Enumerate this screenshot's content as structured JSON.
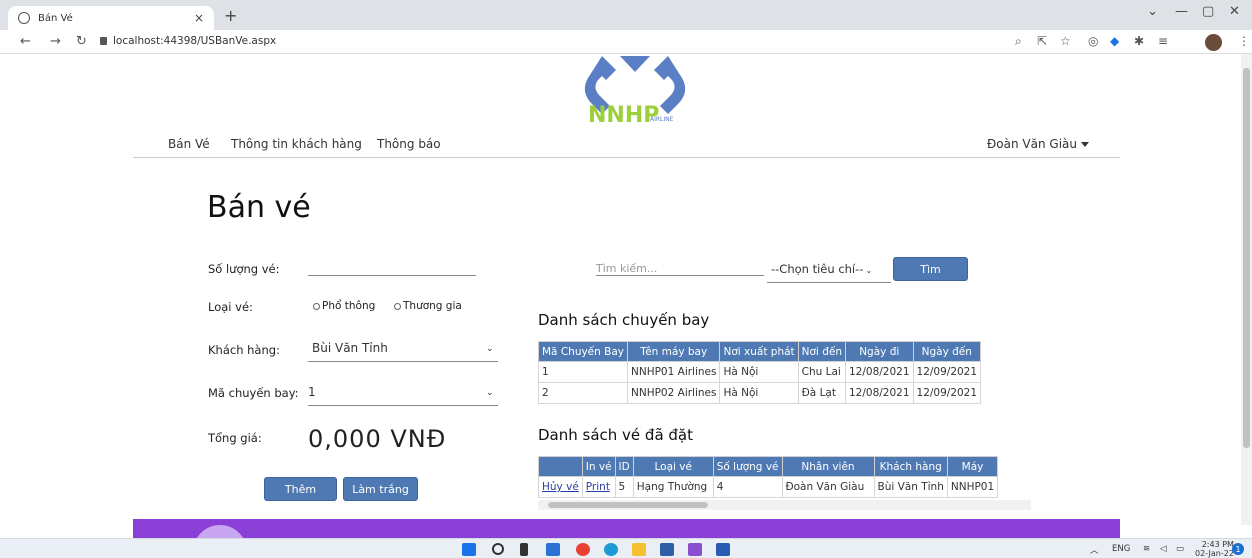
{
  "browser": {
    "tab_title": "Bán Vé",
    "tab_close": "×",
    "new_tab": "+",
    "url": "localhost:44398/USBanVe.aspx"
  },
  "nav": {
    "items": [
      "Bán Vé",
      "Thông tin khách hàng",
      "Thông báo"
    ],
    "user": "Đoàn Văn Giàu"
  },
  "logo": {
    "text": "NNHP",
    "sub": "AIRLINE"
  },
  "page": {
    "title": "Bán vé"
  },
  "form": {
    "qty_label": "Số lượng vé:",
    "qty_value": "",
    "type_label": "Loại vé:",
    "type_options": [
      "Phổ thông",
      "Thương gia"
    ],
    "customer_label": "Khách hàng:",
    "customer_value": "Bùi Văn Tỉnh",
    "flight_label": "Mã chuyến bay:",
    "flight_value": "1",
    "total_label": "Tổng giá:",
    "total_value": "0,000 VNĐ",
    "add_button": "Thêm",
    "clear_button": "Làm trắng"
  },
  "search": {
    "placeholder": "Tìm kiếm...",
    "criteria": "--Chọn tiêu chí--",
    "button": "Tìm"
  },
  "flights": {
    "title": "Danh sách chuyến bay",
    "headers": [
      "Mã Chuyến Bay",
      "Tên máy bay",
      "Nơi xuất phát",
      "Nơi đến",
      "Ngày đi",
      "Ngày đến"
    ],
    "rows": [
      [
        "1",
        "NNHP01 Airlines",
        "Hà Nội",
        "Chu Lai",
        "12/08/2021",
        "12/09/2021"
      ],
      [
        "2",
        "NNHP02 Airlines",
        "Hà Nội",
        "Đà Lạt",
        "12/08/2021",
        "12/09/2021"
      ]
    ]
  },
  "tickets": {
    "title": "Danh sách vé đã đặt",
    "headers": [
      "",
      "In vé",
      "ID",
      "Loại vé",
      "Số lượng vé",
      "Nhân viên",
      "Khách hàng",
      "Máy"
    ],
    "rows": [
      [
        "Hủy vé",
        "Print",
        "5",
        "Hạng Thường",
        "4",
        "Đoàn Văn Giàu",
        "Bùi Văn Tỉnh",
        "NNHP01"
      ]
    ]
  },
  "taskbar": {
    "lang": "ENG",
    "time": "2:43 PM",
    "date": "02-Jan-22",
    "notifications": "1"
  },
  "colors": {
    "accent": "#4f79b3",
    "banner": "#8a3fd6"
  }
}
